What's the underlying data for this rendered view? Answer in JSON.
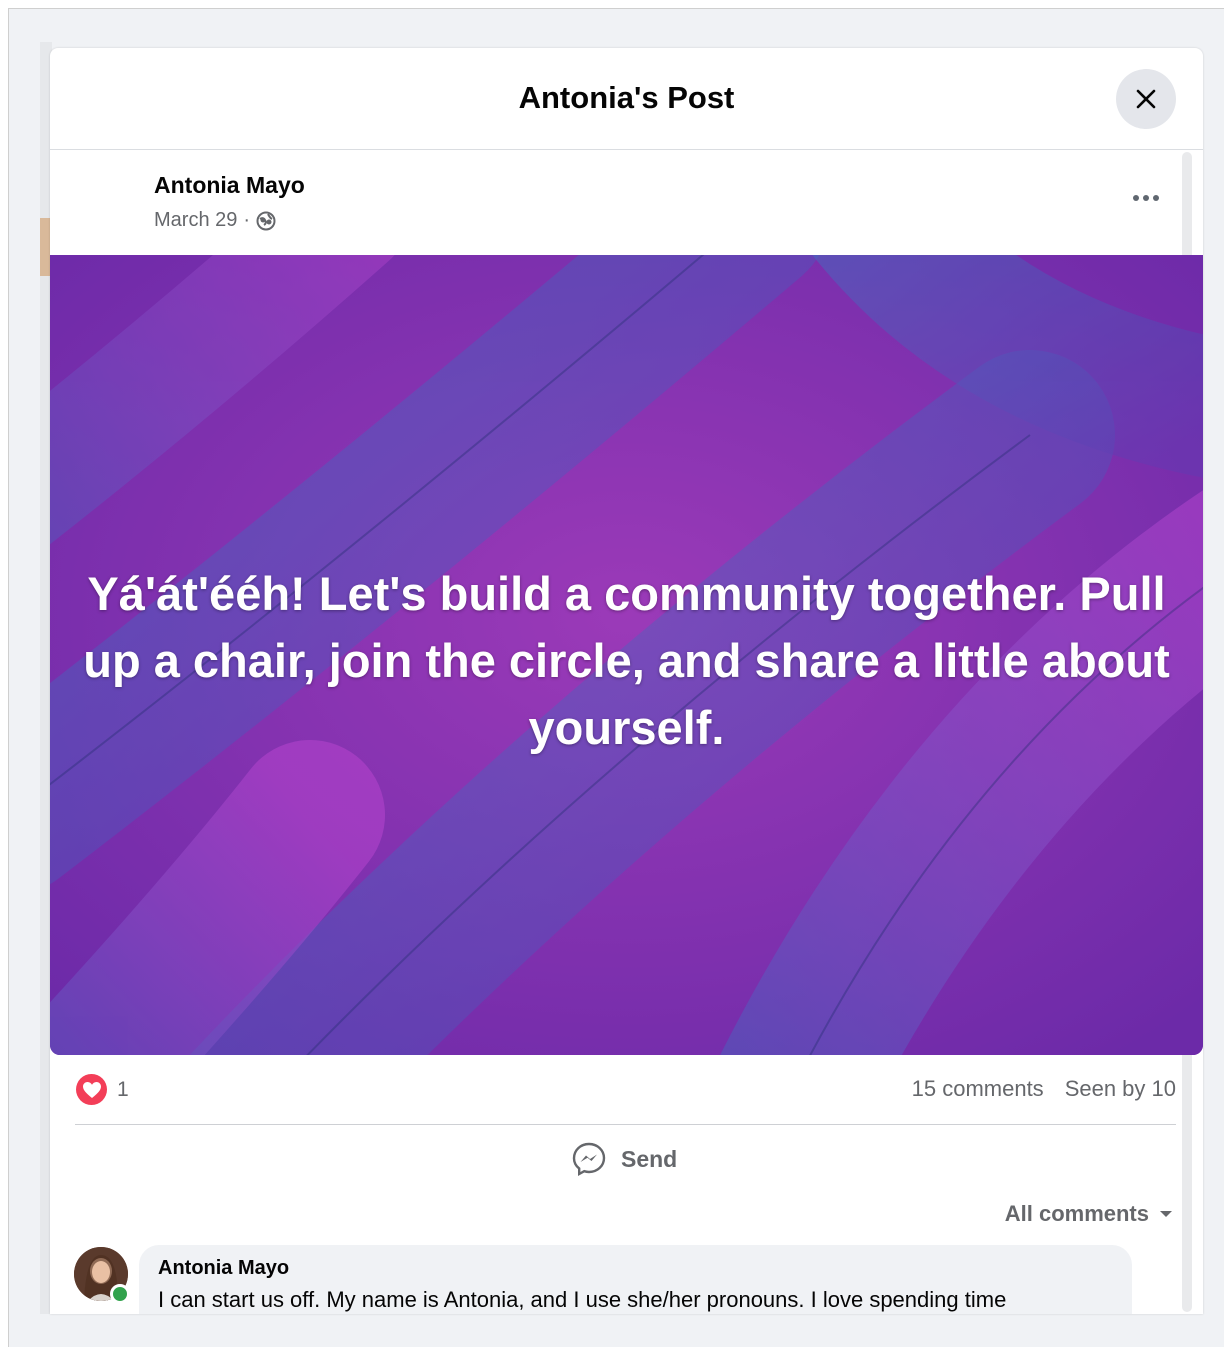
{
  "modal": {
    "title": "Antonia's Post",
    "close_icon": "close-icon"
  },
  "post": {
    "author": "Antonia Mayo",
    "date": "March 29",
    "separator": "·",
    "audience_icon": "public-globe-icon",
    "more_icon": "more-options-icon",
    "image_text": "Yá'át'ééh! Let's build a community together. Pull up a chair, join the circle, and share a little about yourself.",
    "background_colors": [
      "#8a2fb0",
      "#3d5fb8",
      "#c23bd4"
    ]
  },
  "engagement": {
    "reaction_icon": "love-heart-icon",
    "reaction_count": "1",
    "comments": "15 comments",
    "seen": "Seen by 10"
  },
  "actions": {
    "send_label": "Send",
    "send_icon": "messenger-icon"
  },
  "comments": {
    "filter_label": "All comments",
    "items": [
      {
        "author": "Antonia Mayo",
        "text": "I can start us off. My name is Antonia, and I use she/her pronouns. I love spending time"
      }
    ]
  }
}
